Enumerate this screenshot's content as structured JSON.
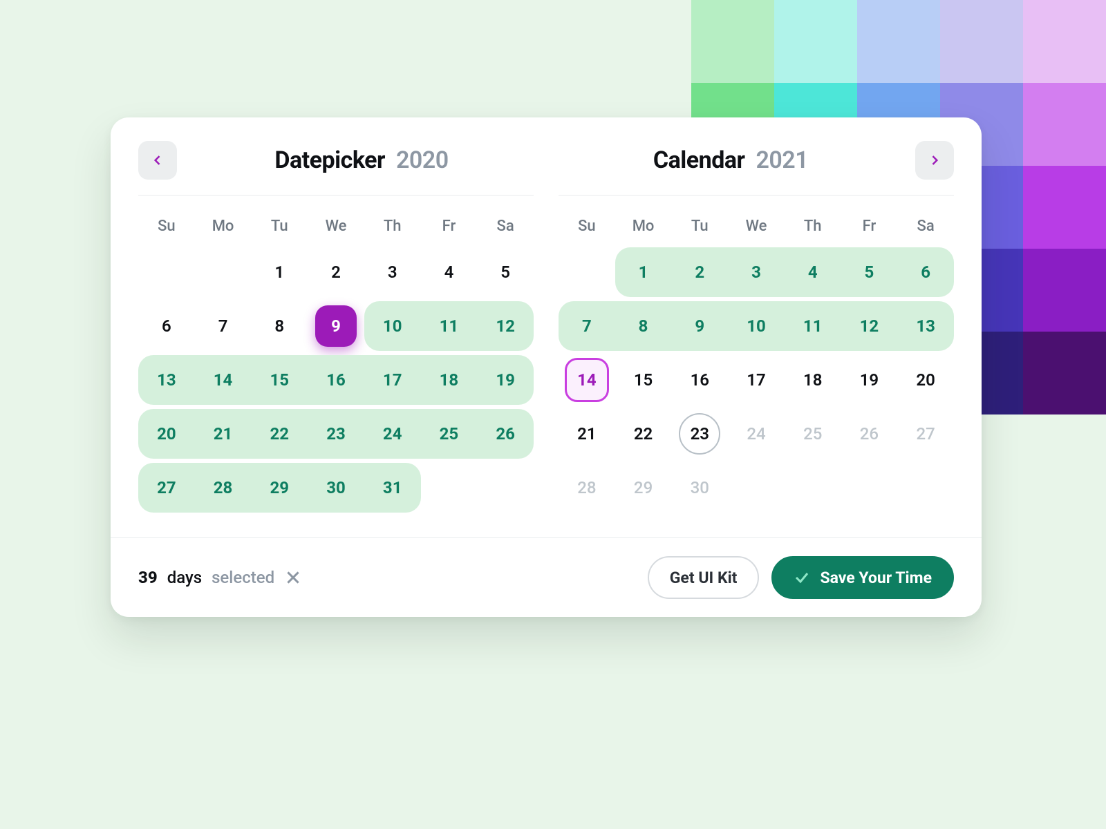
{
  "palette": [
    [
      "#b6eec3",
      "#b0f3ea",
      "#b8cef6",
      "#cac6f2",
      "#e8bff5"
    ],
    [
      "#72e08b",
      "#4de6d8",
      "#72a6f0",
      "#8f8ae8",
      "#d37ef0"
    ],
    [
      "#35c559",
      "#1ed0c3",
      "#3e7fe6",
      "#6a5fde",
      "#b83de6"
    ],
    [
      "#108f3b",
      "#0da59a",
      "#2356c2",
      "#4635b8",
      "#8a1ec4"
    ],
    [
      "#0b5f2a",
      "#0a6a64",
      "#173a8a",
      "#2e1f7a",
      "#4b1070"
    ]
  ],
  "weekdays": [
    "Su",
    "Mo",
    "Tu",
    "We",
    "Th",
    "Fr",
    "Sa"
  ],
  "left": {
    "title": "Datepicker",
    "year": "2020",
    "lead": 2,
    "days": 31,
    "pickSolid": 9,
    "rangeStart": 10,
    "rangeEnd": 31
  },
  "right": {
    "title": "Calendar",
    "year": "2021",
    "lead": 1,
    "days": 30,
    "rangeStart": 1,
    "rangeEnd": 13,
    "pickOutline": 14,
    "today": 23,
    "disabledFrom": 24
  },
  "footer": {
    "count": "39",
    "unit": "days",
    "state": "selected",
    "ghost": "Get UI Kit",
    "primary": "Save Your Time"
  }
}
